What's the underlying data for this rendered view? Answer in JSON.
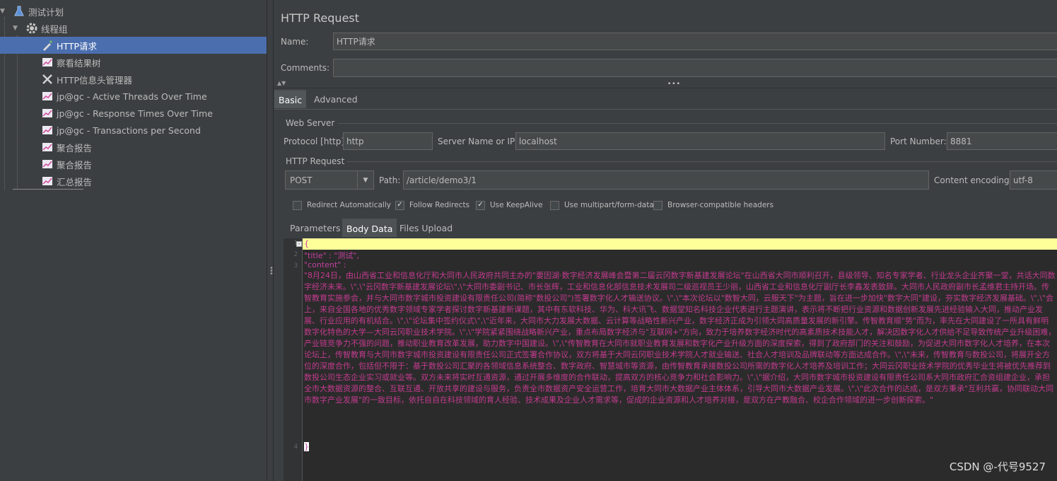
{
  "tree": {
    "items": [
      {
        "label": "测试计划"
      },
      {
        "label": "线程组"
      },
      {
        "label": "HTTP请求"
      },
      {
        "label": "察看结果树"
      },
      {
        "label": "HTTP信息头管理器"
      },
      {
        "label": "jp@gc - Active Threads Over Time"
      },
      {
        "label": "jp@gc - Response Times Over Time"
      },
      {
        "label": "jp@gc - Transactions per Second"
      },
      {
        "label": "聚合报告"
      },
      {
        "label": "聚合报告"
      },
      {
        "label": "汇总报告"
      }
    ]
  },
  "panel": {
    "title": "HTTP Request",
    "name_label": "Name:",
    "name_value": "HTTP请求",
    "comments_label": "Comments:",
    "comments_value": ""
  },
  "tabs": {
    "basic": "Basic",
    "advanced": "Advanced"
  },
  "web_server": {
    "section_title": "Web Server",
    "protocol_label": "Protocol [http]:",
    "protocol_value": "http",
    "server_label": "Server Name or IP:",
    "server_value": "localhost",
    "port_label": "Port Number:",
    "port_value": "8881"
  },
  "http_request": {
    "section_title": "HTTP Request",
    "method": "POST",
    "path_label": "Path:",
    "path_value": "/article/demo3/1",
    "encoding_label": "Content encoding:",
    "encoding_value": "utf-8"
  },
  "options": {
    "redirect_auto": "Redirect Automatically",
    "follow_redirects": "Follow Redirects",
    "keepalive": "Use KeepAlive",
    "multipart": "Use multipart/form-data",
    "browser_headers": "Browser-compatible headers"
  },
  "subtabs": {
    "parameters": "Parameters",
    "body_data": "Body Data",
    "files_upload": "Files Upload"
  },
  "editor": {
    "line_numbers": [
      "1",
      "2",
      "3",
      "4"
    ],
    "line1": "{",
    "line2": "  \"title\" : \"测试\",",
    "line3": "  \"content\" :",
    "content": "\"8月24日，由山西省工业和信息化厅和大同市人民政府共同主办的\"要因湖·数字经济发展峰会暨第二届云冈数字新基建发展论坛\"在山西省大同市顺利召开，县级领导、知名专家学者、行业龙头企业齐聚一堂，共话大同数字经济未来。\\\",\\\"云冈数字新基建发展论坛\\\",\\\"大同市委副书记、市长张辉，工业和信息化部信息技术发展司二级巡视员王少丽，山西省工业和信息化厅副厅长李鑫发表致辞。大同市人民政府副市长孟维君主持开场。传智教育实施参会，并与大同市数字城市投资建设有限责任公司(简称\"数投公司\")签署数字化人才输送协议。\\\",\\\"本次论坛以\"数智大同，云服天下\"为主题，旨在进一步加快\"数字大同\"建设，夯实数字经济发展基础。\\\",\\\"会上，来自全国各地的优秀数字领域专家学者探讨数字新基建新课题，其中有东软科技、华为、科大讯飞、数据堂知名科技企业代表进行主题演讲，表示将不断把行业资源和数据创新发展先进经验输入大同，推动产业发展、行业应用的有机结合。\\\",\\\"论坛集中签约仪式\\\",\\\"近年来，大同市大力发展大数据、云计算等战略性新兴产业，数字经济正成为引领大同高质量发展的新引擎。传智教育顺\"势\"而为，率先在大同建设了一所具有鲜明数字化特色的大学—大同云冈职业技术学院。\\\",\\\"学院紧紧围绕战略新兴产业，重点布局数字经济与\"互联网+\"方向，致力于培养数字经济时代的高素质技术技能人才，解决因数字化人才供给不足导致传统产业升级困难，产业链竞争力不强的问题，推动职业教育改革发展，助力数字中国建设。\\\",\\\"传智教育在大同市就职业教育发展和数字化产业升级方面的深度探索，得到了政府部门的关注和鼓励，为促进大同市数字化人才培养，在本次论坛上，传智教育与大同市数字城市投资建设有限责任公司正式签署合作协议，双方将基于大同云冈职业技术学院人才就业输送、社会人才培训及品牌联动等方面达成合作。\\\",\\\"未来，传智教育与数投公司，将展开全方位的深度合作，包括但不限于：基于数投公司汇聚的各领域信息系统整合、数字政府、智慧城市等资源，由传智教育承接数投公司所需的数字化人才培养及培训工作；大同云冈职业技术学院的优秀毕业生将被优先推荐到数投公司生态企业实习或就业等。双方未来将实时互通资源，通过开展多维度的合作联动，提高双方的核心竞争力和社会影响力。\\\",\\\"据介绍，大同市数字城市投资建设有限责任公司系大同市政府汇合资组建企业，承担全市大数据资源的整合、互联互通、开放共享的建设与服务，负责全市数据资产安全运营工作，培育大同市大数据产业主体体系，引导大同市大数据产业发展。\\\",\\\"此次合作的达成，是双方秉承\"互利共赢，协同联动大同市数字产业发展\"的一致目标，依托自自在科技领域的育人经验、技术成果及企业人才需求等，促成的企业资源和人才培养对接，是双方在产教融合、校企合作领域的进一步创新探索。\"",
    "line4": "}"
  },
  "watermark": "CSDN @-代号9527"
}
